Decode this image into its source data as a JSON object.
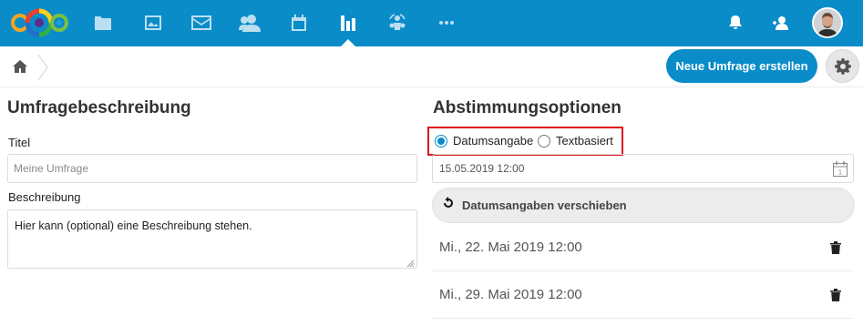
{
  "topbar": {
    "nav": [
      {
        "name": "files-icon"
      },
      {
        "name": "photos-icon"
      },
      {
        "name": "mail-icon"
      },
      {
        "name": "contacts-icon"
      },
      {
        "name": "calendar-icon"
      },
      {
        "name": "polls-icon"
      },
      {
        "name": "circles-icon"
      },
      {
        "name": "more-apps-icon"
      }
    ],
    "active_app": "polls-icon",
    "accent_color": "#0a8cc9"
  },
  "toolbar": {
    "new_poll_label": "Neue Umfrage erstellen"
  },
  "left": {
    "heading": "Umfragebeschreibung",
    "title_label": "Titel",
    "title_placeholder": "Meine Umfrage",
    "description_label": "Beschreibung",
    "description_value": "Hier kann (optional) eine Beschreibung stehen."
  },
  "right": {
    "heading": "Abstimmungsoptionen",
    "type_options": [
      {
        "label": "Datumsangabe",
        "checked": true
      },
      {
        "label": "Textbasiert",
        "checked": false
      }
    ],
    "date_input_value": "15.05.2019 12:00",
    "shift_button_label": "Datumsangaben verschieben",
    "options": [
      {
        "label": "Mi., 22. Mai 2019 12:00"
      },
      {
        "label": "Mi., 29. Mai 2019 12:00"
      }
    ],
    "highlight_color": "#e0141b"
  }
}
